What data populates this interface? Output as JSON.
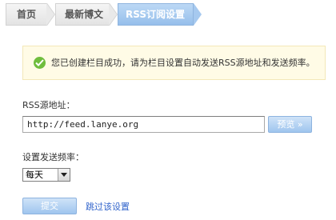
{
  "breadcrumb": {
    "steps": [
      {
        "label": "首页",
        "state": "done"
      },
      {
        "label": "最新博文",
        "state": "done"
      },
      {
        "label": "RSS订阅设置",
        "state": "current"
      }
    ]
  },
  "notice": {
    "icon": "check-circle-icon",
    "text": "您已创建栏目成功，请为栏目设置自动发送RSS源地址和发送频率。"
  },
  "rss": {
    "label": "RSS源地址：",
    "value": "http://feed.lanye.org",
    "preview_label": "预览 »"
  },
  "frequency": {
    "label": "设置发送频率：",
    "selected": "每天"
  },
  "actions": {
    "submit_label": "提交",
    "skip_label": "跳过该设置"
  },
  "colors": {
    "accent": "#9fc5ee",
    "notice_bg": "#fffbe6",
    "success": "#6fbd3d",
    "link": "#3366cc"
  }
}
